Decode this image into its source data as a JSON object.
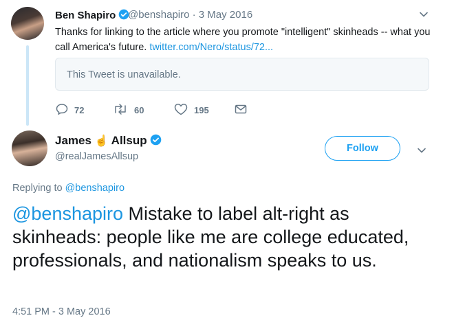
{
  "tweet1": {
    "author_name": "Ben Shapiro",
    "author_handle": "@benshapiro",
    "separator": " · ",
    "date": "3 May 2016",
    "text_before": "Thanks for linking to the article where you promote \"intelligent\" skinheads -- what you call America's future. ",
    "link_text": "twitter.com/Nero/status/72...",
    "quoted_unavailable": "This Tweet is unavailable.",
    "actions": {
      "replies": "72",
      "retweets": "60",
      "likes": "195"
    }
  },
  "tweet2": {
    "author_name_before": "James ",
    "author_name_emoji": "☝",
    "author_name_after": " Allsup",
    "author_handle": "@realJamesAllsup",
    "follow_label": "Follow",
    "replying_prefix": "Replying to ",
    "replying_to": "@benshapiro",
    "mention": "@benshapiro",
    "text": " Mistake to label alt-right as skinheads: people like me are college educated, professionals, and nationalism speaks to us.",
    "timestamp": "4:51 PM - 3 May 2016"
  },
  "colors": {
    "link_blue": "#1b95e0",
    "follow_blue": "#1da1f2",
    "muted_gray": "#657786",
    "text_dark": "#14171a",
    "thread_line": "#cce6f7"
  }
}
